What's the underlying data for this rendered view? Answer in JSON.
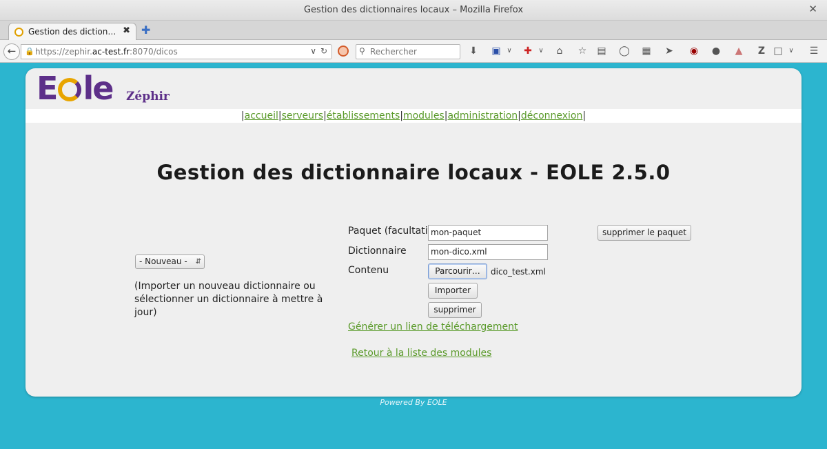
{
  "window": {
    "title": "Gestion des dictionnaires locaux – Mozilla Firefox",
    "close_glyph": "✕"
  },
  "tab": {
    "label": "Gestion des diction…",
    "close_glyph": "✖",
    "new_tab_glyph": "✚"
  },
  "navbar": {
    "url_prefix": "https://zephir.",
    "url_domain": "ac-test.fr",
    "url_suffix": ":8070/dicos",
    "search_placeholder": "Rechercher"
  },
  "site": {
    "logo_text": "EOLE",
    "app_name": "Zéphir",
    "menu": [
      {
        "label": "accueil"
      },
      {
        "label": "serveurs"
      },
      {
        "label": "établissements"
      },
      {
        "label": "modules"
      },
      {
        "label": "administration"
      },
      {
        "label": "déconnexion"
      }
    ],
    "menu_separator": "|"
  },
  "main": {
    "page_title": "Gestion des dictionnaire locaux - EOLE 2.5.0",
    "select_value": "- Nouveau -",
    "import_hint": "(Importer un nouveau dictionnaire ou sélectionner un dictionnaire à mettre à jour)",
    "package_label": "Paquet (facultatif)",
    "package_value": "mon-paquet",
    "delete_package_label": "supprimer le paquet",
    "dictionary_label": "Dictionnaire",
    "dictionary_value": "mon-dico.xml",
    "content_label": "Contenu",
    "browse_label": "Parcourir…",
    "file_name": "dico_test.xml",
    "import_label": "Importer",
    "delete_label": "supprimer",
    "download_link": "Générer un lien de téléchargement",
    "back_link": "Retour à la liste des modules"
  },
  "footer": {
    "powered": "Powered By EOLE"
  },
  "colors": {
    "accent_link": "#5a9a2a",
    "brand": "#5d2f89",
    "background": "#2cb5cf"
  }
}
